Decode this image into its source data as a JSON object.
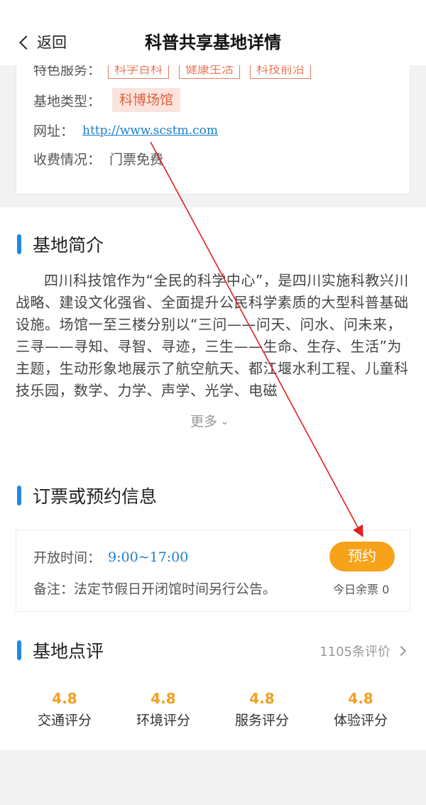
{
  "header": {
    "back_label": "返回",
    "title": "科普共享基地详情"
  },
  "info": {
    "features_label": "特色服务：",
    "features": [
      "科学百科",
      "健康生活",
      "科技前沿"
    ],
    "type_label": "基地类型：",
    "type_value": "科博场馆",
    "url_label": "网址：",
    "url_value": "http://www.scstm.com",
    "fee_label": "收费情况：",
    "fee_value": "门票免费"
  },
  "intro": {
    "title": "基地简介",
    "text": "四川科技馆作为“全民的科学中心”，是四川实施科教兴川战略、建设文化强省、全面提升公民科学素质的大型科普基础设施。场馆一至三楼分别以“三问——问天、问水、问未来，三寻——寻知、寻智、寻迹，三生——生命、生存、生活”为主题，生动形象地展示了航空航天、都江堰水利工程、儿童科技乐园，数学、力学、声学、光学、电磁",
    "more_label": "更多"
  },
  "booking": {
    "title": "订票或预约信息",
    "open_label": "开放时间：",
    "open_time": "9:00~17:00",
    "note": "备注：法定节假日开闭馆时间另行公告。",
    "reserve_label": "预约",
    "tickets_label": "今日余票 0"
  },
  "reviews": {
    "title": "基地点评",
    "count_label": "1105条评价",
    "scores": [
      {
        "value": "4.8",
        "label": "交通评分"
      },
      {
        "value": "4.8",
        "label": "环境评分"
      },
      {
        "value": "4.8",
        "label": "服务评分"
      },
      {
        "value": "4.8",
        "label": "体验评分"
      }
    ]
  },
  "colors": {
    "accent_blue": "#1e88e5",
    "link_blue": "#1a7fcc",
    "tag_orange": "#e87a5a",
    "button_orange": "#f7a21b",
    "score_orange": "#f5a020",
    "annotation_red": "#e02020"
  }
}
